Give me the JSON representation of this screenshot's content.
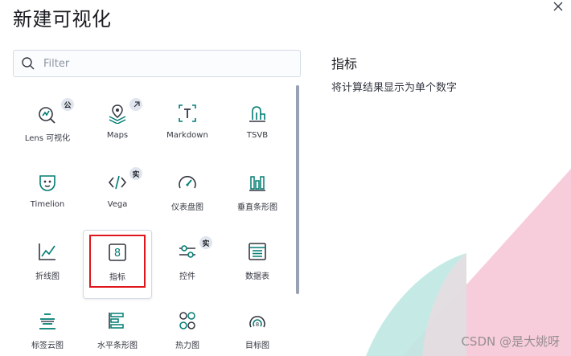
{
  "modal": {
    "title": "新建可视化",
    "close_icon": "close-icon"
  },
  "search": {
    "placeholder": "Filter",
    "value": ""
  },
  "items": [
    {
      "label": "Lens 可视化",
      "icon": "lens-icon",
      "badge": "公"
    },
    {
      "label": "Maps",
      "icon": "maps-icon",
      "badge": "external-link-icon"
    },
    {
      "label": "Markdown",
      "icon": "markdown-icon"
    },
    {
      "label": "TSVB",
      "icon": "tsvb-icon"
    },
    {
      "label": "Timelion",
      "icon": "timelion-icon"
    },
    {
      "label": "Vega",
      "icon": "vega-icon",
      "badge": "实"
    },
    {
      "label": "仪表盘图",
      "icon": "gauge-icon"
    },
    {
      "label": "垂直条形图",
      "icon": "vertical-bar-icon"
    },
    {
      "label": "折线图",
      "icon": "line-chart-icon"
    },
    {
      "label": "指标",
      "icon": "metric-icon",
      "selected": true
    },
    {
      "label": "控件",
      "icon": "controls-icon",
      "badge": "实"
    },
    {
      "label": "数据表",
      "icon": "data-table-icon"
    },
    {
      "label": "标签云图",
      "icon": "tag-cloud-icon"
    },
    {
      "label": "水平条形图",
      "icon": "horizontal-bar-icon"
    },
    {
      "label": "热力图",
      "icon": "heatmap-icon"
    },
    {
      "label": "目标图",
      "icon": "goal-icon"
    }
  ],
  "description": {
    "title": "指标",
    "text": "将计算结果显示为单个数字"
  },
  "watermark": "CSDN @是大姚呀",
  "colors": {
    "icon": "#017d73",
    "highlight": "#e0151a",
    "badge_bg": "#e0e5ee"
  }
}
